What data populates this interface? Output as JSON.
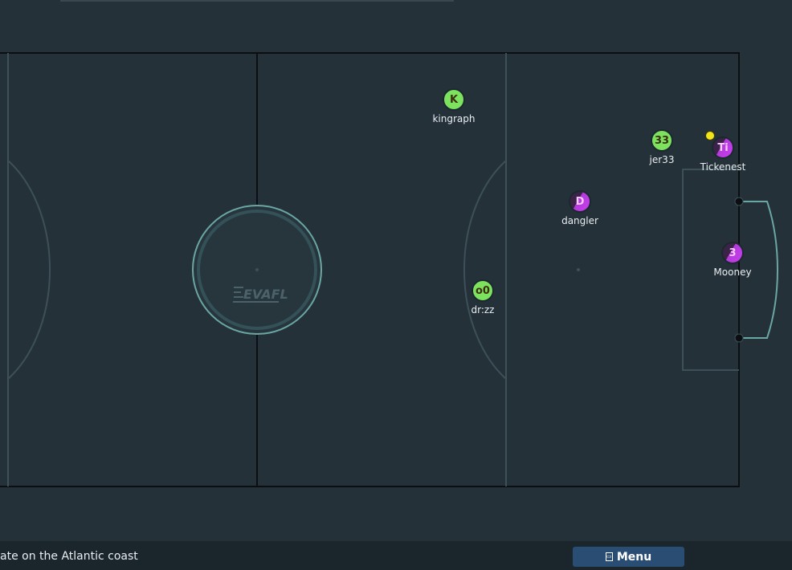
{
  "pitch": {
    "colors": {
      "background": "#253138",
      "outline": "#0b0f12",
      "field_lines": "#3d5059",
      "goal": "#6aa6a6",
      "center_circle": "#6aa6a6"
    },
    "logo_text": "EVAFL"
  },
  "players": [
    {
      "label": "K",
      "name": "kingraph",
      "team": "green"
    },
    {
      "label": "33",
      "name": "jer33",
      "team": "green"
    },
    {
      "label": "Ti",
      "name": "Tickenest",
      "team": "purple"
    },
    {
      "label": "D",
      "name": "dangler",
      "team": "purple"
    },
    {
      "label": "o0",
      "name": "dr:zz",
      "team": "green"
    },
    {
      "label": "3",
      "name": "Mooney",
      "team": "purple"
    }
  ],
  "team_colors": {
    "green": "#7de25e",
    "purple": "#c93ff0",
    "ball": "#f2e31a"
  },
  "chat": {
    "line1": "ate on the Atlantic coast",
    "line2": "...."
  },
  "menu": {
    "icon": "floppy-disk-icon",
    "label": "Menu"
  }
}
